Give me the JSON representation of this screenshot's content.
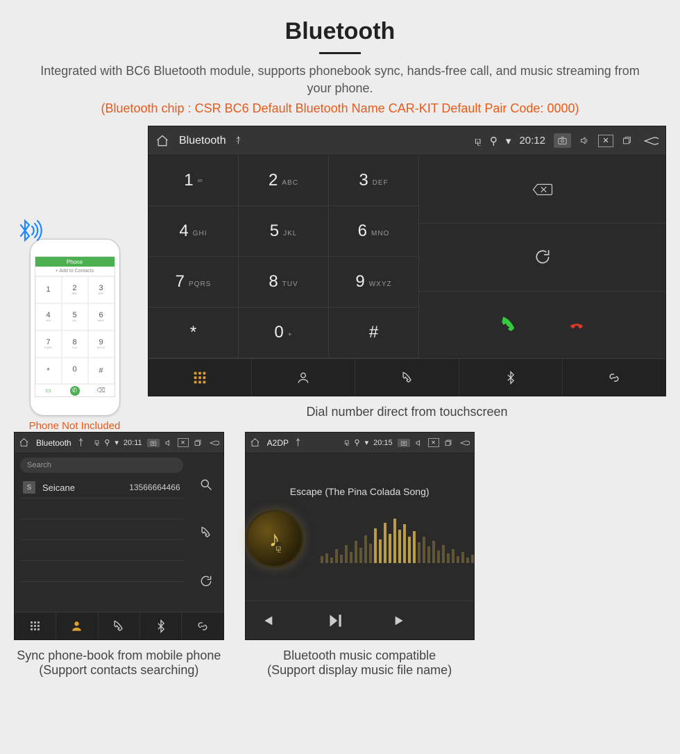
{
  "header": {
    "title": "Bluetooth",
    "description": "Integrated with BC6 Bluetooth module, supports phonebook sync, hands-free call, and music streaming from your phone.",
    "specs": "(Bluetooth chip : CSR BC6     Default Bluetooth Name CAR-KIT     Default Pair Code: 0000)"
  },
  "phone": {
    "top_label": "Phone",
    "add_contacts": "+ Add to Contacts",
    "keys": [
      {
        "d": "1",
        "s": ""
      },
      {
        "d": "2",
        "s": "ABC"
      },
      {
        "d": "3",
        "s": "DEF"
      },
      {
        "d": "4",
        "s": "GHI"
      },
      {
        "d": "5",
        "s": "JKL"
      },
      {
        "d": "6",
        "s": "MNO"
      },
      {
        "d": "7",
        "s": "PQRS"
      },
      {
        "d": "8",
        "s": "TUV"
      },
      {
        "d": "9",
        "s": "WXYZ"
      },
      {
        "d": "*",
        "s": ""
      },
      {
        "d": "0",
        "s": "+"
      },
      {
        "d": "#",
        "s": ""
      }
    ],
    "caption": "Phone Not Included"
  },
  "headunit_dialer": {
    "status": {
      "title": "Bluetooth",
      "time": "20:12"
    },
    "keys": [
      {
        "d": "1",
        "s": "∞"
      },
      {
        "d": "2",
        "s": "ABC"
      },
      {
        "d": "3",
        "s": "DEF"
      },
      {
        "d": "4",
        "s": "GHI"
      },
      {
        "d": "5",
        "s": "JKL"
      },
      {
        "d": "6",
        "s": "MNO"
      },
      {
        "d": "7",
        "s": "PQRS"
      },
      {
        "d": "8",
        "s": "TUV"
      },
      {
        "d": "9",
        "s": "WXYZ"
      },
      {
        "d": "*",
        "s": ""
      },
      {
        "d": "0",
        "s": "+"
      },
      {
        "d": "#",
        "s": ""
      }
    ],
    "caption": "Dial number direct from touchscreen"
  },
  "contacts_panel": {
    "status": {
      "title": "Bluetooth",
      "time": "20:11"
    },
    "search_placeholder": "Search",
    "contact": {
      "initial": "S",
      "name": "Seicane",
      "number": "13566664466"
    },
    "caption_line1": "Sync phone-book from mobile phone",
    "caption_line2": "(Support contacts searching)"
  },
  "music_panel": {
    "status": {
      "title": "A2DP",
      "time": "20:15"
    },
    "song": "Escape (The Pina Colada Song)",
    "viz_heights": [
      10,
      14,
      8,
      20,
      12,
      26,
      16,
      32,
      22,
      40,
      28,
      50,
      34,
      58,
      42,
      64,
      48,
      56,
      38,
      46,
      30,
      38,
      24,
      32,
      18,
      26,
      14,
      20,
      10,
      16,
      8,
      12
    ],
    "caption_line1": "Bluetooth music compatible",
    "caption_line2": "(Support display music file name)"
  }
}
